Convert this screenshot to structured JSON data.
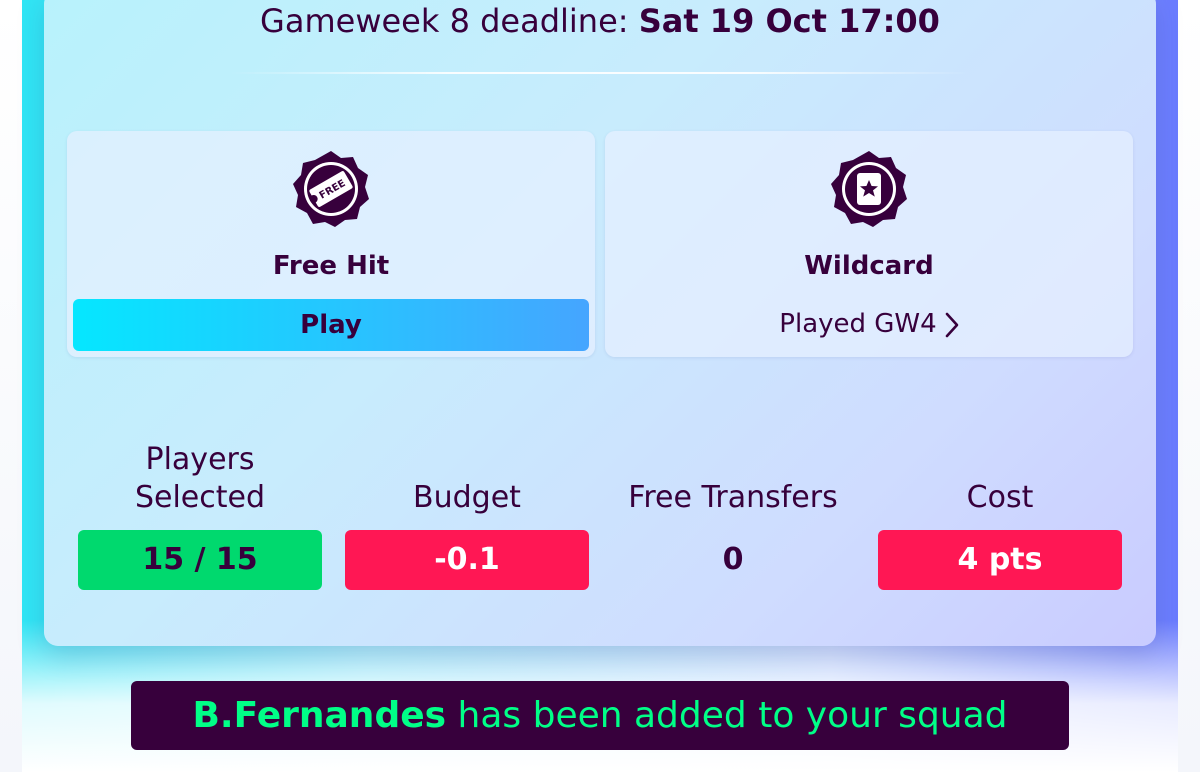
{
  "deadline": {
    "label": "Gameweek 8 deadline:",
    "value": "Sat 19 Oct 17:00"
  },
  "chips": [
    {
      "name": "Free Hit",
      "icon": "free-hit-ticket-icon",
      "icon_badge_text": "FREE",
      "action_label": "Play"
    },
    {
      "name": "Wildcard",
      "icon": "wildcard-card-icon",
      "status_label": "Played GW4"
    }
  ],
  "stats": {
    "players_selected": {
      "label_line1": "Players",
      "label_line2": "Selected",
      "value": "15 / 15"
    },
    "budget": {
      "label": "Budget",
      "value": "-0.1"
    },
    "free_transfers": {
      "label": "Free Transfers",
      "value": "0"
    },
    "cost": {
      "label": "Cost",
      "value": "4 pts"
    }
  },
  "toast": {
    "player": "B.Fernandes",
    "message": "has been added to your squad"
  },
  "colors": {
    "primary_purple": "#37003c",
    "status_green": "#00d96e",
    "status_red": "#ff1754",
    "toast_text_green": "#00ff87",
    "play_gradient_start": "#05e7ff",
    "play_gradient_end": "#45a5ff"
  }
}
